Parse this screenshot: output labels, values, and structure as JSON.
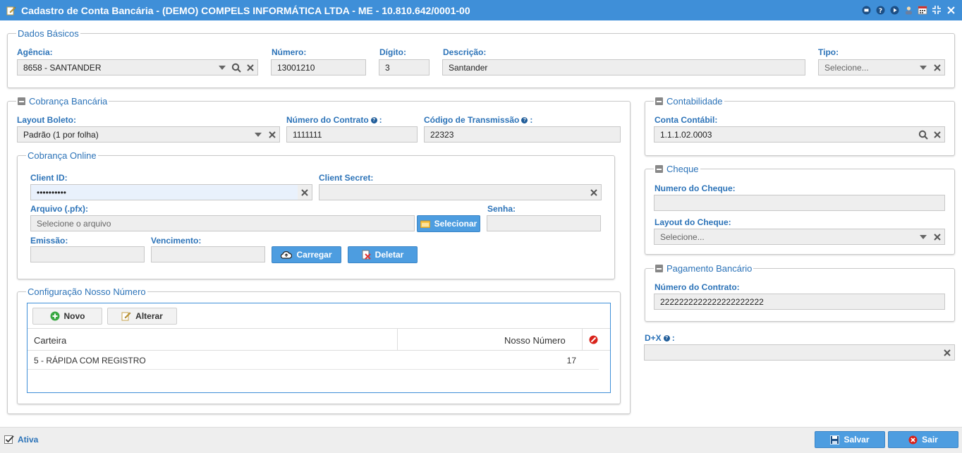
{
  "window": {
    "title": "Cadastro de Conta Bancária - (DEMO) COMPELS INFORMÁTICA LTDA - ME - 10.810.642/0001-00"
  },
  "dados_basicos": {
    "legend": "Dados Básicos",
    "agencia_label": "Agência:",
    "agencia_value": "8658 - SANTANDER",
    "numero_label": "Número:",
    "numero_value": "13001210",
    "digito_label": "Dígito:",
    "digito_value": "3",
    "descricao_label": "Descrição:",
    "descricao_value": "Santander",
    "tipo_label": "Tipo:",
    "tipo_placeholder": "Selecione..."
  },
  "cobranca": {
    "legend": "Cobrança Bancária",
    "layout_label": "Layout Boleto:",
    "layout_value": "Padrão (1 por folha)",
    "contrato_label": "Número do Contrato",
    "contrato_value": "1111111",
    "transmissao_label": "Código de Transmissão",
    "transmissao_value": "22323",
    "colon": ":"
  },
  "online": {
    "legend": "Cobrança Online",
    "client_id_label": "Client ID:",
    "client_id_value": "••••••••••",
    "client_secret_label": "Client Secret:",
    "arquivo_label": "Arquivo (.pfx):",
    "arquivo_placeholder": "Selecione o arquivo",
    "selecionar_label": "Selecionar",
    "senha_label": "Senha:",
    "emissao_label": "Emissão:",
    "vencimento_label": "Vencimento:",
    "carregar_label": "Carregar",
    "deletar_label": "Deletar"
  },
  "nosso_numero": {
    "legend": "Configuração Nosso Número",
    "novo_label": "Novo",
    "alterar_label": "Alterar",
    "col_carteira": "Carteira",
    "col_nosso_numero": "Nosso Número",
    "rows": [
      {
        "carteira": "5 - RÁPIDA COM REGISTRO",
        "nosso_numero": "17"
      }
    ]
  },
  "contabilidade": {
    "legend": "Contabilidade",
    "conta_label": "Conta Contábil:",
    "conta_value": "1.1.1.02.0003"
  },
  "cheque": {
    "legend": "Cheque",
    "numero_label": "Numero do Cheque:",
    "layout_label": "Layout do Cheque:",
    "layout_placeholder": "Selecione..."
  },
  "pagamento": {
    "legend": "Pagamento Bancário",
    "contrato_label": "Número do Contrato:",
    "contrato_value": "2222222222222222222222"
  },
  "dx": {
    "label": "D+X",
    "colon": ":"
  },
  "footer": {
    "ativa_label": "Ativa",
    "salvar_label": "Salvar",
    "sair_label": "Sair"
  },
  "colors": {
    "titlebar": "#3f8fd8",
    "label_blue": "#2c73b8",
    "button_blue": "#4d9de0"
  }
}
